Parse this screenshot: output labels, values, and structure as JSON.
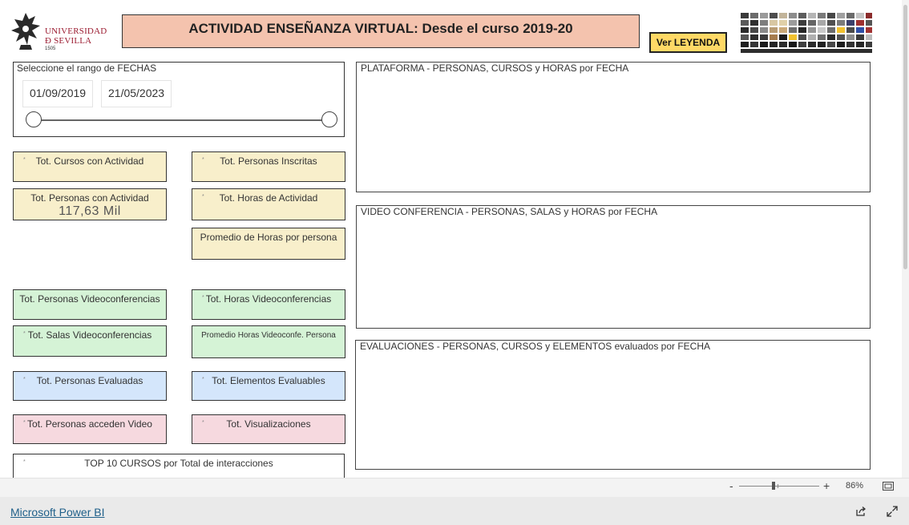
{
  "header": {
    "logo_line1": "UNIVERSIDAD",
    "logo_line2": "Ð SEVILLA",
    "logo_year": "1505",
    "title": "ACTIVIDAD ENSEÑANZA VIRTUAL: Desde el curso 2019-20",
    "legend_button": "Ver LEYENDA"
  },
  "date_filter": {
    "label": "Seleccione el rango de FECHAS",
    "start": "01/09/2019",
    "end": "21/05/2023"
  },
  "cards": [
    {
      "label": "Tot. Cursos con Actividad",
      "value": ""
    },
    {
      "label": "Tot. Personas Inscritas",
      "value": ""
    },
    {
      "label": "Tot. Personas con Actividad",
      "value": "117,63 Mil"
    },
    {
      "label": "Tot. Horas de Actividad",
      "value": ""
    },
    {
      "label": "Promedio de Horas por persona",
      "value": ""
    },
    {
      "label": "Tot. Personas Videoconferencias",
      "value": ""
    },
    {
      "label": "Tot. Horas Videoconferencias",
      "value": ""
    },
    {
      "label": "Tot. Salas Videoconferencias",
      "value": ""
    },
    {
      "label": "Promedio Horas Videoconfe. Persona",
      "value": ""
    },
    {
      "label": "Tot. Personas Evaluadas",
      "value": ""
    },
    {
      "label": "Tot. Elementos Evaluables",
      "value": ""
    },
    {
      "label": "Tot. Personas acceden Video",
      "value": ""
    },
    {
      "label": "Tot. Visualizaciones",
      "value": ""
    },
    {
      "label": "TOP 10 CURSOS por Total de interacciones",
      "value": ""
    }
  ],
  "charts": {
    "plataforma": "PLATAFORMA - PERSONAS, CURSOS y HORAS por FECHA",
    "video": "VIDEO CONFERENCIA - PERSONAS, SALAS y HORAS por FECHA",
    "evaluaciones": "EVALUACIONES - PERSONAS, CURSOS y ELEMENTOS evaluados por FECHA"
  },
  "statusbar": {
    "zoom_minus": "-",
    "zoom_plus": "+",
    "zoom_percent": "86%"
  },
  "footer": {
    "link": "Microsoft Power BI"
  },
  "colors": {
    "title_bg": "#f4c3ae",
    "legend_bg": "#ffd966",
    "yellow_card": "#f8efcb",
    "green_card": "#d5f3d6",
    "blue_card": "#d4e6fb",
    "pink_card": "#f6d9df",
    "logo_red": "#9b1b30"
  },
  "icons": [
    "university-seal-icon",
    "share-icon",
    "expand-icon",
    "fit-to-page-icon"
  ]
}
